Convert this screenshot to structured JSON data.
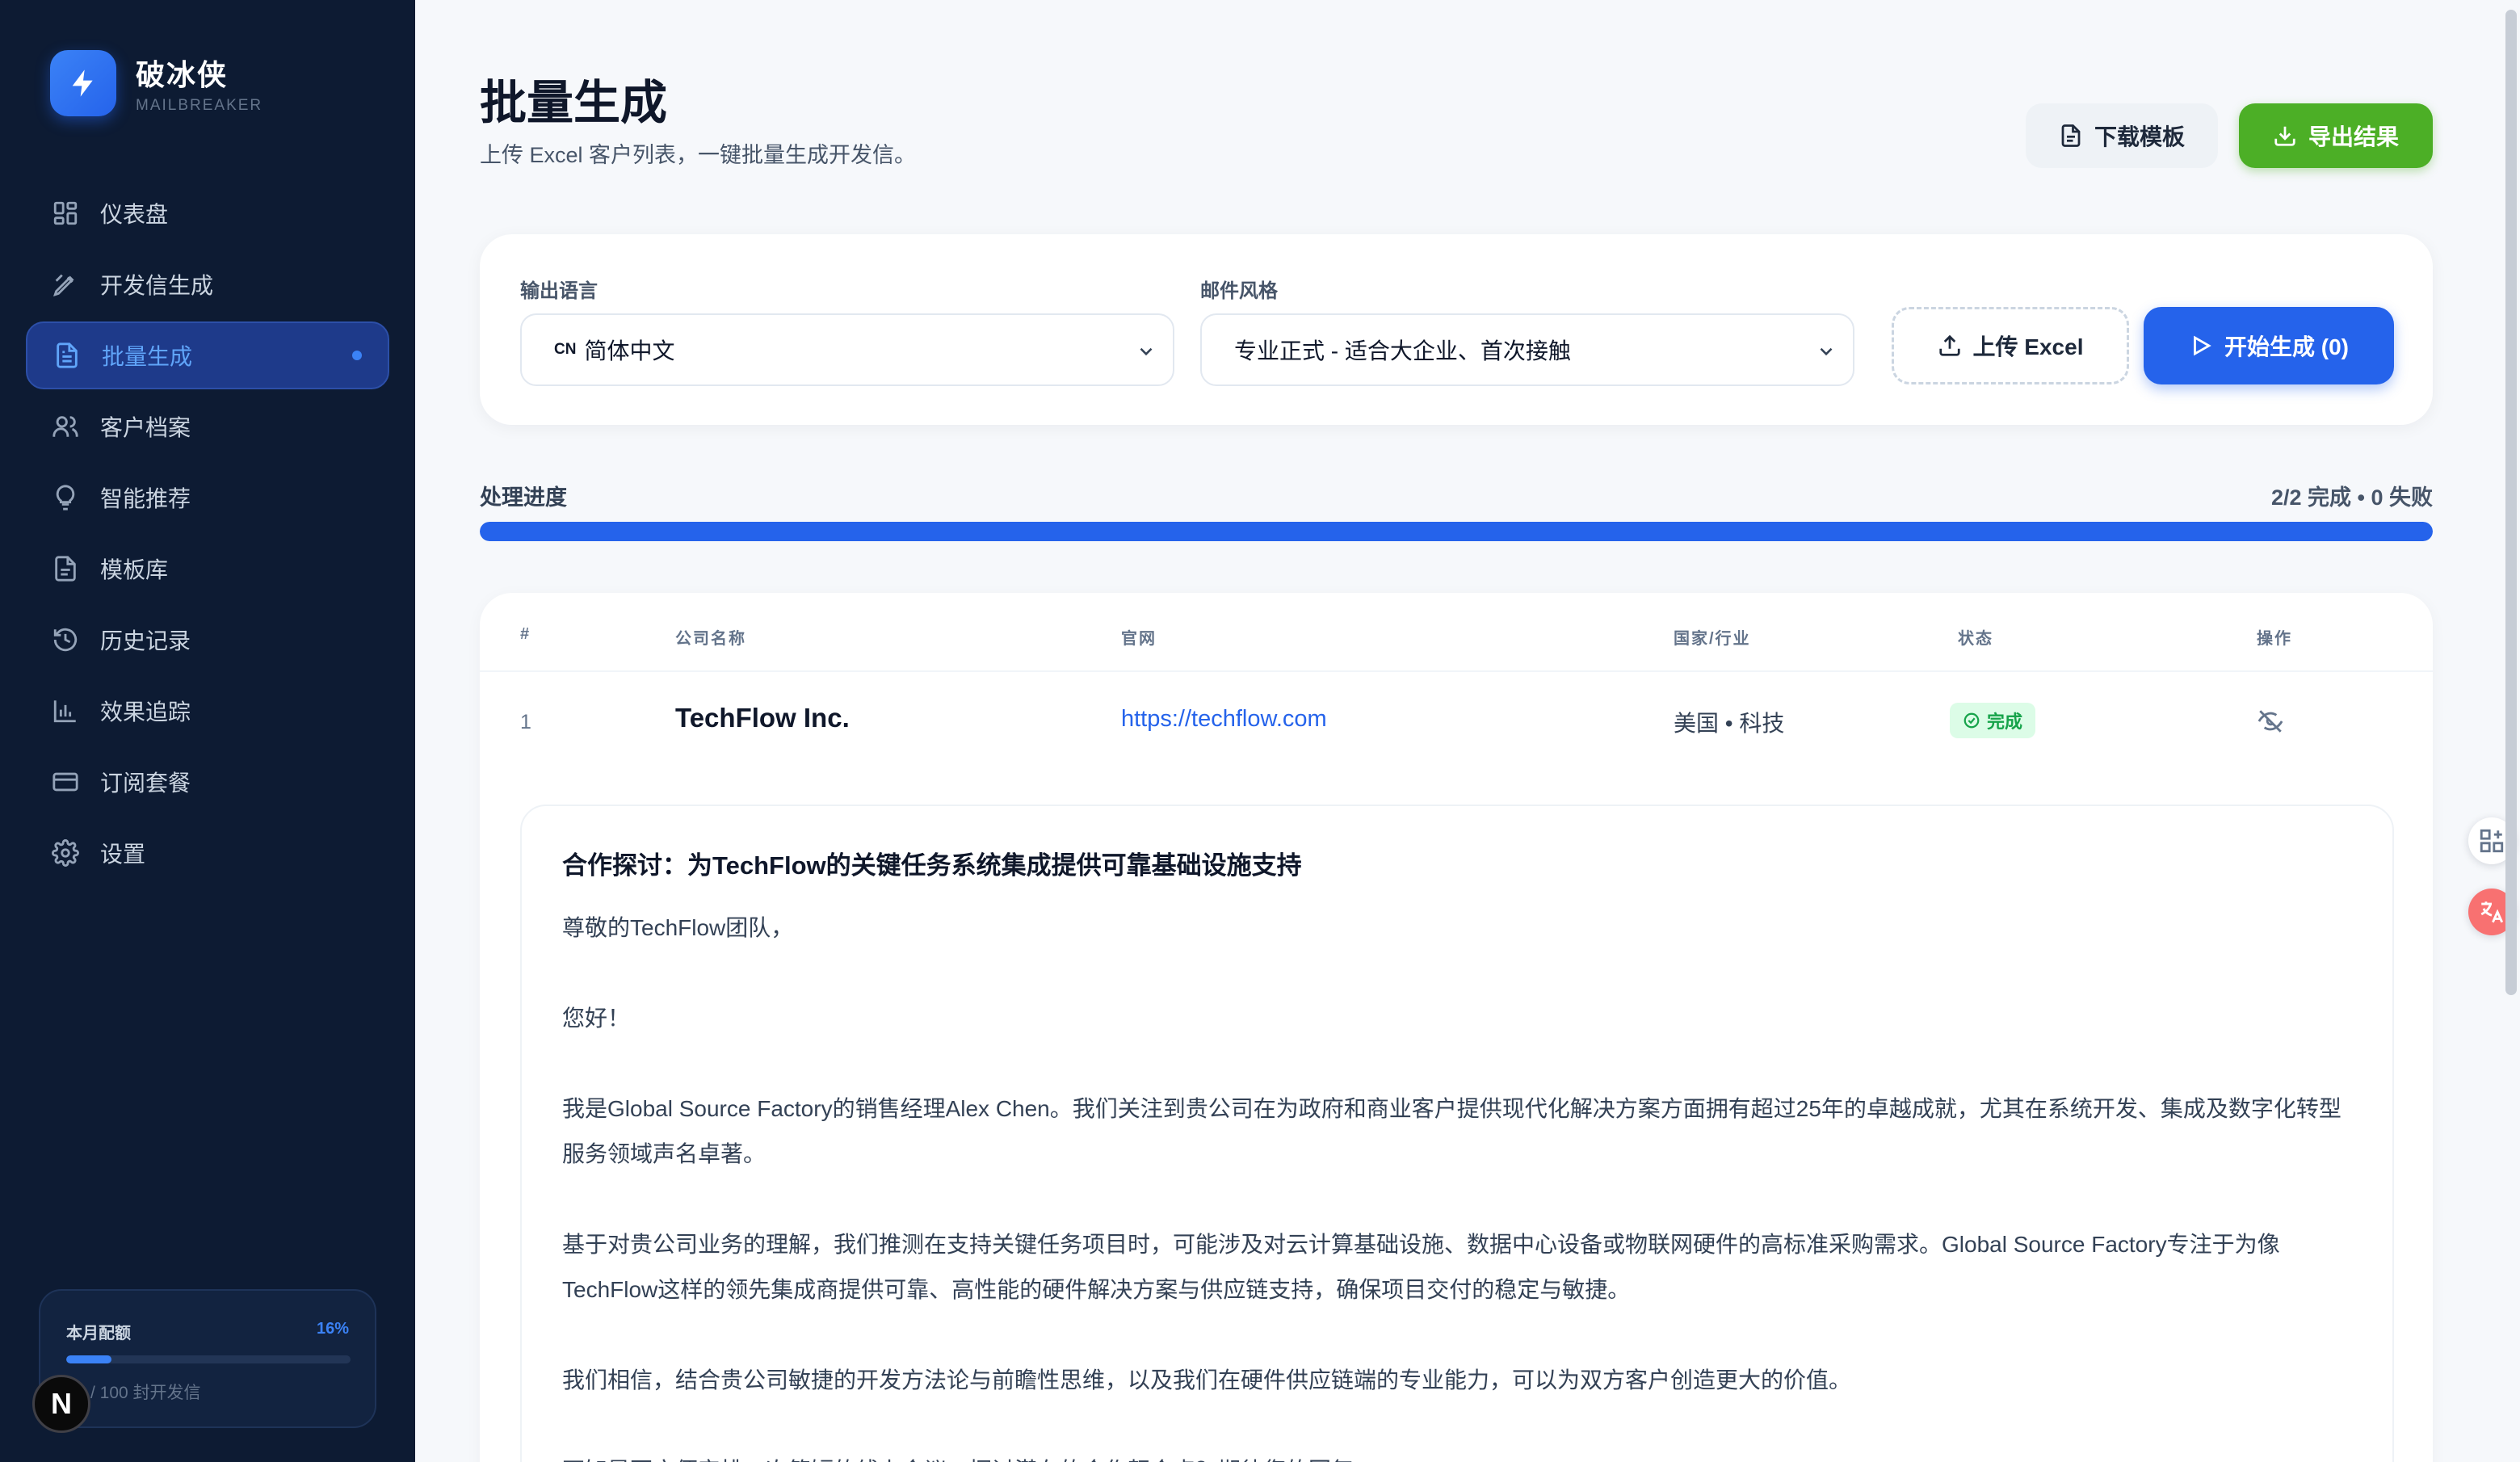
{
  "brand": {
    "name": "破冰侠",
    "sub": "MAILBREAKER"
  },
  "nav": [
    {
      "label": "仪表盘",
      "icon": "dashboard-icon"
    },
    {
      "label": "开发信生成",
      "icon": "pen-icon"
    },
    {
      "label": "批量生成",
      "icon": "file-list-icon",
      "active": true
    },
    {
      "label": "客户档案",
      "icon": "users-icon"
    },
    {
      "label": "智能推荐",
      "icon": "lightbulb-icon"
    },
    {
      "label": "模板库",
      "icon": "file-icon"
    },
    {
      "label": "历史记录",
      "icon": "history-icon"
    },
    {
      "label": "效果追踪",
      "icon": "bar-chart-icon"
    },
    {
      "label": "订阅套餐",
      "icon": "card-icon"
    },
    {
      "label": "设置",
      "icon": "gear-icon"
    }
  ],
  "quota": {
    "title": "本月配额",
    "percent_label": "16%",
    "percent": 16,
    "text": "/ 100 封开发信"
  },
  "page": {
    "title": "批量生成",
    "subtitle": "上传 Excel 客户列表，一键批量生成开发信。"
  },
  "actions": {
    "download_template": "下载模板",
    "export_results": "导出结果"
  },
  "form": {
    "language_label": "输出语言",
    "language_flag": "CN",
    "language_value": "简体中文",
    "style_label": "邮件风格",
    "style_value": "专业正式 - 适合大企业、首次接触",
    "upload_label": "上传 Excel",
    "start_label": "开始生成 (0)"
  },
  "progress": {
    "label": "处理进度",
    "stats": "2/2 完成 • 0 失败",
    "fraction": 1.0
  },
  "table": {
    "headers": [
      "#",
      "公司名称",
      "官网",
      "国家/行业",
      "状态",
      "操作"
    ],
    "row": {
      "index": "1",
      "company": "TechFlow Inc.",
      "website": "https://techflow.com",
      "country_industry": "美国 • 科技",
      "status": "完成"
    }
  },
  "email": {
    "subject": "合作探讨：为TechFlow的关键任务系统集成提供可靠基础设施支持",
    "paragraphs": [
      "尊敬的TechFlow团队，",
      "您好！",
      "我是Global Source Factory的销售经理Alex Chen。我们关注到贵公司在为政府和商业客户提供现代化解决方案方面拥有超过25年的卓越成就，尤其在系统开发、集成及数字化转型服务领域声名卓著。",
      "基于对贵公司业务的理解，我们推测在支持关键任务项目时，可能涉及对云计算基础设施、数据中心设备或物联网硬件的高标准采购需求。Global Source Factory专注于为像TechFlow这样的领先集成商提供可靠、高性能的硬件解决方案与供应链支持，确保项目交付的稳定与敏捷。",
      "我们相信，结合贵公司敏捷的开发方法论与前瞻性思维，以及我们在硬件供应链端的专业能力，可以为双方客户创造更大的价值。",
      "不知是否方便安排一次简短的线上会议，探讨潜在的合作契合点？期待您的回复。"
    ]
  },
  "colors": {
    "primary": "#2563eb",
    "success": "#4caf26",
    "sidebar": "#0d1b33"
  }
}
